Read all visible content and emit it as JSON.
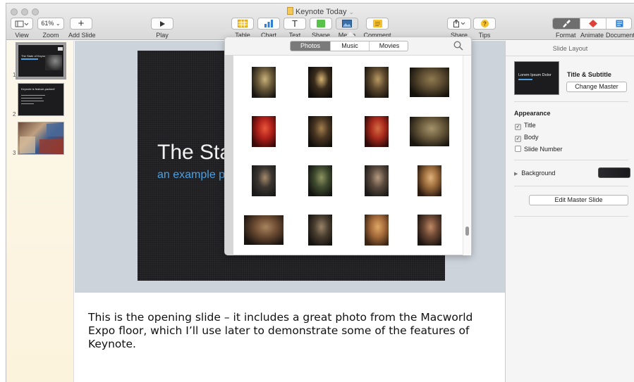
{
  "window": {
    "title": "Keynote Today",
    "title_caret": "⌄"
  },
  "toolbar": {
    "view_label": "View",
    "zoom_value": "61%",
    "zoom_label": "Zoom",
    "add_slide_label": "Add Slide",
    "play_label": "Play",
    "table_label": "Table",
    "chart_label": "Chart",
    "text_label": "Text",
    "shape_label": "Shape",
    "media_label": "Media",
    "comment_label": "Comment",
    "share_label": "Share",
    "tips_label": "Tips",
    "format_label": "Format",
    "animate_label": "Animate",
    "document_label": "Document",
    "colors": {
      "table": "#f5c12e",
      "chart": "#2f80d1",
      "shape": "#58c14a",
      "comment": "#f5c12e",
      "tips": "#f5c12e",
      "animate": "#e0403a",
      "document": "#2f80d1"
    }
  },
  "navigator": {
    "slides": [
      {
        "number": "1",
        "title": "The State of Keynote Today",
        "selected": true
      },
      {
        "number": "2",
        "title": "Keynote is feature-packed!",
        "selected": false
      },
      {
        "number": "3",
        "title": "",
        "selected": false
      }
    ]
  },
  "slide": {
    "title": "The State of Keynote Today",
    "subtitle": "an example presentation"
  },
  "notes": {
    "text": "This is the opening slide – it includes a great photo from the Macworld Expo floor, which I’ll use later to demonstrate some of the features of Keynote."
  },
  "inspector": {
    "header": "Slide Layout",
    "master_thumb_text": "Lorem Ipsum Dolor",
    "master_name": "Title & Subtitle",
    "change_master_label": "Change Master",
    "appearance_label": "Appearance",
    "title_checkbox": "Title",
    "body_checkbox": "Body",
    "slide_number_checkbox": "Slide Number",
    "background_label": "Background",
    "edit_master_label": "Edit Master Slide",
    "title_checked": true,
    "body_checked": true,
    "slide_number_checked": false
  },
  "media_browser": {
    "tabs": [
      "Photos",
      "Music",
      "Movies"
    ],
    "active_tab": "Photos",
    "photos": [
      {
        "name": "photo-cave-1",
        "palette": [
          "#1a1712",
          "#6b5a3a",
          "#c9b27a"
        ]
      },
      {
        "name": "photo-cave-2",
        "palette": [
          "#0f0d0b",
          "#3a2c1c",
          "#d8b472"
        ]
      },
      {
        "name": "photo-cave-3",
        "palette": [
          "#1b1610",
          "#5f4a2e",
          "#b89a62"
        ]
      },
      {
        "name": "photo-cave-4",
        "palette": [
          "#15120c",
          "#5a4a30",
          "#8f7a4f"
        ]
      },
      {
        "name": "photo-cave-red-1",
        "palette": [
          "#3a0a08",
          "#b0201a",
          "#e8583a"
        ]
      },
      {
        "name": "photo-cave-5",
        "palette": [
          "#120f0b",
          "#4a3622",
          "#a37f4e"
        ]
      },
      {
        "name": "photo-cave-red-2",
        "palette": [
          "#2e0a08",
          "#a82a1c",
          "#d46c42"
        ]
      },
      {
        "name": "photo-cave-6",
        "palette": [
          "#1b1710",
          "#6a5a3c",
          "#a4936a"
        ]
      },
      {
        "name": "photo-hat-person",
        "palette": [
          "#1a1a1a",
          "#3a3530",
          "#a58a6a"
        ]
      },
      {
        "name": "photo-cave-7",
        "palette": [
          "#121410",
          "#3f4a2e",
          "#8d9460"
        ]
      },
      {
        "name": "photo-two-people",
        "palette": [
          "#1c1a18",
          "#5a4a3e",
          "#b69a80"
        ]
      },
      {
        "name": "photo-cave-8",
        "palette": [
          "#2a1a10",
          "#9a6a3a",
          "#e0b27a"
        ]
      },
      {
        "name": "photo-cave-9",
        "palette": [
          "#1a1410",
          "#6a4a30",
          "#a88460"
        ]
      },
      {
        "name": "photo-man-hat",
        "palette": [
          "#15130f",
          "#4a3e30",
          "#9a8468"
        ]
      },
      {
        "name": "photo-cave-10",
        "palette": [
          "#3a2414",
          "#a46a3a",
          "#e0a866"
        ]
      },
      {
        "name": "photo-selfie",
        "palette": [
          "#1b1511",
          "#6a4632",
          "#c08a66"
        ]
      }
    ]
  }
}
